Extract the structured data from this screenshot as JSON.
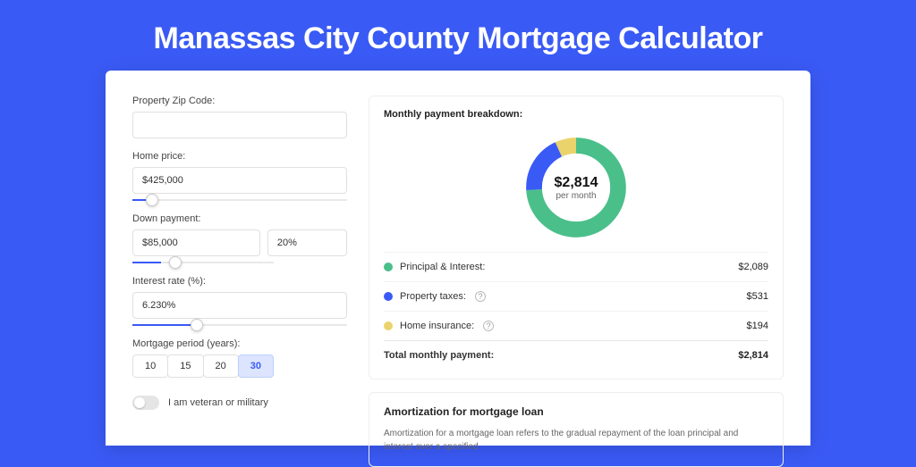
{
  "page": {
    "title": "Manassas City County Mortgage Calculator"
  },
  "form": {
    "zip_label": "Property Zip Code:",
    "zip_value": "",
    "home_price_label": "Home price:",
    "home_price_value": "$425,000",
    "home_price_slider_pct": 9,
    "down_payment_label": "Down payment:",
    "down_payment_value": "$85,000",
    "down_payment_pct_value": "20%",
    "down_payment_slider_pct": 20,
    "rate_label": "Interest rate (%):",
    "rate_value": "6.230%",
    "rate_slider_pct": 30,
    "period_label": "Mortgage period (years):",
    "periods": [
      "10",
      "15",
      "20",
      "30"
    ],
    "period_active": "30",
    "veteran_label": "I am veteran or military"
  },
  "breakdown": {
    "title": "Monthly payment breakdown:",
    "donut_value": "$2,814",
    "donut_sub": "per month",
    "items": [
      {
        "label": "Principal & Interest:",
        "value": "$2,089",
        "color": "green",
        "help": false
      },
      {
        "label": "Property taxes:",
        "value": "$531",
        "color": "blue",
        "help": true
      },
      {
        "label": "Home insurance:",
        "value": "$194",
        "color": "yellow",
        "help": true
      }
    ],
    "total_label": "Total monthly payment:",
    "total_value": "$2,814"
  },
  "amort": {
    "title": "Amortization for mortgage loan",
    "text": "Amortization for a mortgage loan refers to the gradual repayment of the loan principal and interest over a specified"
  },
  "chart_data": {
    "type": "pie",
    "title": "Monthly payment breakdown",
    "series": [
      {
        "name": "Principal & Interest",
        "value": 2089,
        "color": "#4abf8a"
      },
      {
        "name": "Property taxes",
        "value": 531,
        "color": "#3a5af5"
      },
      {
        "name": "Home insurance",
        "value": 194,
        "color": "#ebd36c"
      }
    ],
    "total": 2814
  }
}
